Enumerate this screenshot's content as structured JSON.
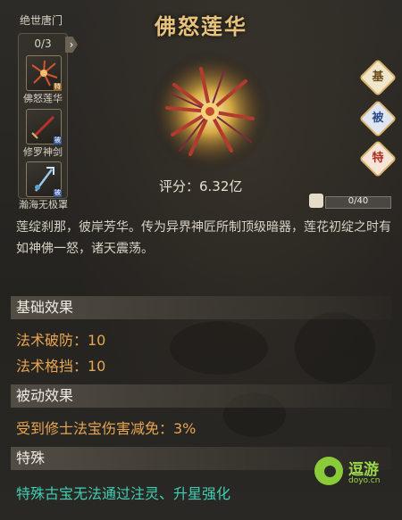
{
  "header": {
    "title": "佛怒莲华"
  },
  "category_tab": "绝世唐门",
  "series": {
    "count": "0/3",
    "items": [
      {
        "label": "佛怒莲华",
        "icon": "lotus-icon",
        "mark": "特"
      },
      {
        "label": "修罗神剑",
        "icon": "sword-icon",
        "mark": "被"
      },
      {
        "label": "瀚海无极罩",
        "icon": "trident-icon",
        "mark": "被"
      }
    ]
  },
  "side_badges": [
    {
      "label": "基",
      "color": "#f0e6cc",
      "text_color": "#6b4a1a"
    },
    {
      "label": "被",
      "color": "#dfe6f2",
      "text_color": "#2c4d8a"
    },
    {
      "label": "特",
      "color": "#f5e4d8",
      "text_color": "#b02a1e"
    }
  ],
  "score": {
    "text": "评分：6.32亿"
  },
  "progress": {
    "text": "0/40",
    "value": 0
  },
  "description": "莲绽刹那，彼岸芳华。传为异界神匠所制顶级暗器，莲花初绽之时有如神佛一怒，诸天震荡。",
  "sections": {
    "basic": {
      "title": "基础效果",
      "attrs": [
        "法术破防：10",
        "法术格挡：10"
      ]
    },
    "passive": {
      "title": "被动效果",
      "attrs": [
        "受到修士法宝伤害减免：3%"
      ]
    },
    "special": {
      "title": "特殊",
      "text": "特殊古宝无法通过注灵、升星强化"
    }
  },
  "watermark": {
    "name": "逗游",
    "url": "doyo.cn"
  },
  "colors": {
    "accent": "#e8c27a",
    "attr": "#e8a552",
    "special": "#3fcfb2"
  }
}
